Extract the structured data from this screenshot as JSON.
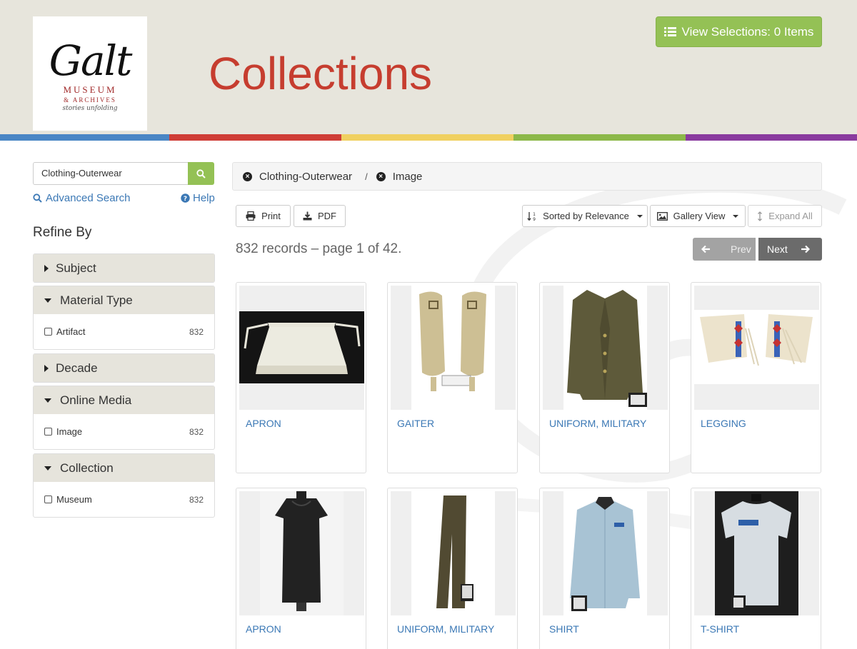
{
  "header": {
    "logo": {
      "script": "Galt",
      "line1": "MUSEUM",
      "line2": "& ARCHIVES",
      "line3": "stories unfolding"
    },
    "title": "Collections",
    "view_selections": "View Selections: 0 Items"
  },
  "colors": {
    "accent_green": "#94c155",
    "title_red": "#c63d2f",
    "link_blue": "#3b78b5",
    "stripe": [
      "#4a86c5",
      "#cf3d36",
      "#f0d060",
      "#8cb849",
      "#8a3b9e"
    ]
  },
  "sidebar": {
    "search_value": "Clothing-Outerwear",
    "advanced_search": "Advanced Search",
    "help": "Help",
    "refine_by": "Refine By",
    "facets": [
      {
        "label": "Subject",
        "expanded": false,
        "items": []
      },
      {
        "label": "Material Type",
        "expanded": true,
        "items": [
          {
            "label": "Artifact",
            "count": "832"
          }
        ]
      },
      {
        "label": "Decade",
        "expanded": false,
        "items": []
      },
      {
        "label": "Online Media",
        "expanded": true,
        "items": [
          {
            "label": "Image",
            "count": "832"
          }
        ]
      },
      {
        "label": "Collection",
        "expanded": true,
        "items": [
          {
            "label": "Museum",
            "count": "832"
          }
        ]
      }
    ]
  },
  "breadcrumb": {
    "items": [
      "Clothing-Outerwear",
      "Image"
    ],
    "separator": "/"
  },
  "toolbar": {
    "print": "Print",
    "pdf": "PDF",
    "sort": "Sorted by Relevance",
    "view": "Gallery View",
    "expand_all": "Expand All"
  },
  "results": {
    "summary": "832 records – page 1 of 42.",
    "prev": "Prev",
    "next": "Next",
    "cards": [
      {
        "title": "APRON",
        "icon": "apron"
      },
      {
        "title": "GAITER",
        "icon": "gaiter"
      },
      {
        "title": "UNIFORM, MILITARY",
        "icon": "jacket"
      },
      {
        "title": "LEGGING",
        "icon": "legging"
      },
      {
        "title": "APRON",
        "icon": "dress"
      },
      {
        "title": "UNIFORM, MILITARY",
        "icon": "trousers"
      },
      {
        "title": "SHIRT",
        "icon": "shirt"
      },
      {
        "title": "T-SHIRT",
        "icon": "tshirt"
      }
    ]
  }
}
